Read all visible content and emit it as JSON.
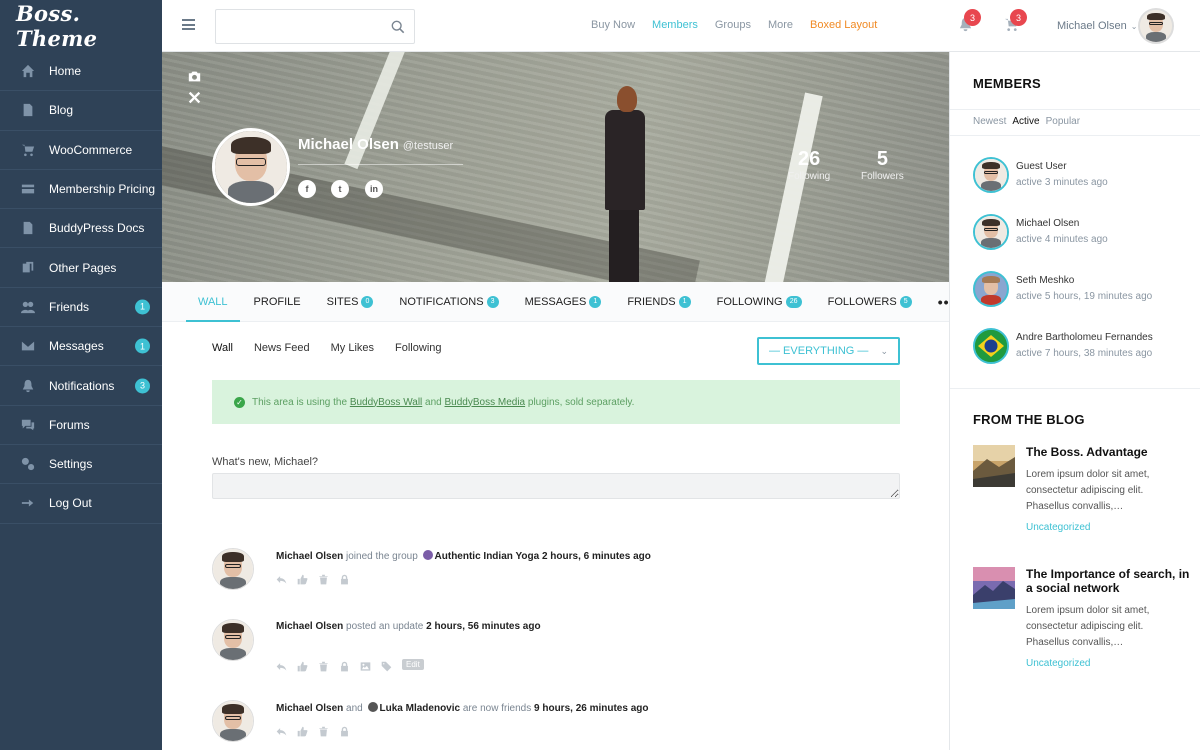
{
  "app": {
    "logo": "Boss. Theme"
  },
  "sidebar": {
    "items": [
      {
        "label": "Home",
        "icon": "home-icon"
      },
      {
        "label": "Blog",
        "icon": "document-icon"
      },
      {
        "label": "WooCommerce",
        "icon": "cart-icon"
      },
      {
        "label": "Membership Pricing",
        "icon": "card-icon"
      },
      {
        "label": "BuddyPress Docs",
        "icon": "document-icon"
      },
      {
        "label": "Other Pages",
        "icon": "pages-icon"
      },
      {
        "label": "Friends",
        "icon": "friends-icon",
        "badge": "1"
      },
      {
        "label": "Messages",
        "icon": "mail-icon",
        "badge": "1"
      },
      {
        "label": "Notifications",
        "icon": "bell-icon",
        "badge": "3"
      },
      {
        "label": "Forums",
        "icon": "chat-icon"
      },
      {
        "label": "Settings",
        "icon": "gear-icon"
      },
      {
        "label": "Log Out",
        "icon": "logout-icon"
      }
    ]
  },
  "topbar": {
    "search_placeholder": "",
    "nav": [
      "Buy Now",
      "Members",
      "Groups",
      "More",
      "Boxed Layout"
    ],
    "active_nav": "Members",
    "notifications_count": "3",
    "cart_count": "3",
    "user_name": "Michael Olsen"
  },
  "profile": {
    "name": "Michael Olsen",
    "handle": "@testuser",
    "following_count": "26",
    "following_label": "Following",
    "followers_count": "5",
    "followers_label": "Followers",
    "social": [
      "f",
      "t",
      "in"
    ]
  },
  "tabs": [
    {
      "label": "WALL",
      "active": true
    },
    {
      "label": "PROFILE"
    },
    {
      "label": "SITES",
      "badge": "0"
    },
    {
      "label": "NOTIFICATIONS",
      "badge": "3"
    },
    {
      "label": "MESSAGES",
      "badge": "1"
    },
    {
      "label": "FRIENDS",
      "badge": "1"
    },
    {
      "label": "FOLLOWING",
      "badge": "26"
    },
    {
      "label": "FOLLOWERS",
      "badge": "5"
    }
  ],
  "more_tabs": "•••",
  "subtabs": [
    "Wall",
    "News Feed",
    "My Likes",
    "Following"
  ],
  "filter": {
    "value": "— EVERYTHING —"
  },
  "notice": {
    "pre": "This area is using the ",
    "link1": "BuddyBoss Wall",
    "mid": " and ",
    "link2": "BuddyBoss Media",
    "post": " plugins, sold separately."
  },
  "post_form": {
    "label": "What's new, Michael?"
  },
  "activity": [
    {
      "actor": "Michael Olsen",
      "action": " joined the group ",
      "target": "Authentic Indian Yoga",
      "time": " 2 hours, 6 minutes ago"
    },
    {
      "actor": "Michael Olsen",
      "action": " posted an update ",
      "target": "",
      "time": "2 hours, 56 minutes ago",
      "edit": "Edit"
    },
    {
      "actor": "Michael Olsen",
      "action": " and ",
      "target": "Luka Mladenovic",
      "action2": " are now friends ",
      "time": "9 hours, 26 minutes ago"
    }
  ],
  "members_widget": {
    "title": "MEMBERS",
    "filters": [
      "Newest",
      "Active",
      "Popular"
    ],
    "active_filter": "Active",
    "members": [
      {
        "name": "Guest User",
        "status": "active 3 minutes ago"
      },
      {
        "name": "Michael Olsen",
        "status": "active 4 minutes ago"
      },
      {
        "name": "Seth Meshko",
        "status": "active 5 hours, 19 minutes ago"
      },
      {
        "name": "Andre Bartholomeu Fernandes",
        "status": "active 7 hours, 38 minutes ago"
      }
    ]
  },
  "blog_widget": {
    "title": "FROM THE BLOG",
    "posts": [
      {
        "title": "The Boss. Advantage",
        "excerpt": "Lorem ipsum dolor sit amet, consectetur adipiscing elit. Phasellus convallis,…",
        "category": "Uncategorized"
      },
      {
        "title": "The Importance of search, in a social network",
        "excerpt": "Lorem ipsum dolor sit amet, consectetur adipiscing elit. Phasellus convallis,…",
        "category": "Uncategorized"
      }
    ]
  },
  "colors": {
    "accent": "#3ec1d3",
    "sidebar": "#2f4257",
    "badge_red": "#e8474f",
    "boxed_layout": "#f08a24",
    "notice_bg": "#d9f3dd"
  }
}
